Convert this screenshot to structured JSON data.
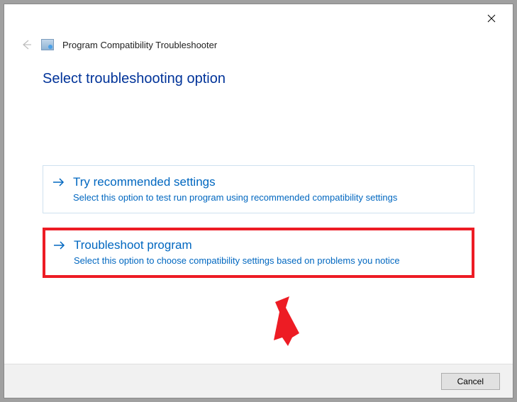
{
  "header": {
    "title": "Program Compatibility Troubleshooter"
  },
  "main": {
    "heading": "Select troubleshooting option"
  },
  "options": [
    {
      "title": "Try recommended settings",
      "description": "Select this option to test run program using recommended compatibility settings"
    },
    {
      "title": "Troubleshoot program",
      "description": "Select this option to choose compatibility settings based on problems you notice"
    }
  ],
  "footer": {
    "cancel_label": "Cancel"
  }
}
